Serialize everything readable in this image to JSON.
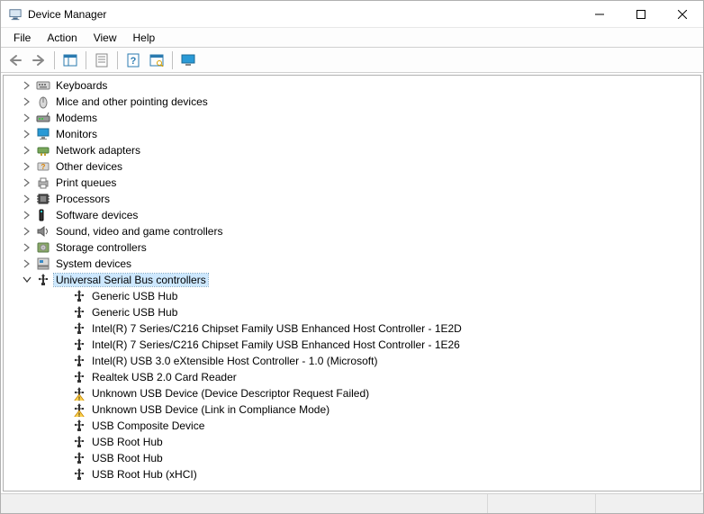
{
  "window": {
    "title": "Device Manager"
  },
  "menu": {
    "file": "File",
    "action": "Action",
    "view": "View",
    "help": "Help"
  },
  "toolbar_icons": {
    "back": "back-icon",
    "forward": "forward-icon",
    "show_hide": "show-hide-console-tree-icon",
    "properties": "properties-icon",
    "help": "help-icon",
    "scan": "scan-hardware-icon",
    "view_devices": "view-devices-icon"
  },
  "tree": {
    "nodes": [
      {
        "label": "Keyboards",
        "icon": "keyboard-icon",
        "expanded": false
      },
      {
        "label": "Mice and other pointing devices",
        "icon": "mouse-icon",
        "expanded": false
      },
      {
        "label": "Modems",
        "icon": "modem-icon",
        "expanded": false
      },
      {
        "label": "Monitors",
        "icon": "monitor-icon",
        "expanded": false
      },
      {
        "label": "Network adapters",
        "icon": "network-adapter-icon",
        "expanded": false
      },
      {
        "label": "Other devices",
        "icon": "other-device-icon",
        "expanded": false
      },
      {
        "label": "Print queues",
        "icon": "printer-icon",
        "expanded": false
      },
      {
        "label": "Processors",
        "icon": "processor-icon",
        "expanded": false
      },
      {
        "label": "Software devices",
        "icon": "software-device-icon",
        "expanded": false
      },
      {
        "label": "Sound, video and game controllers",
        "icon": "sound-icon",
        "expanded": false
      },
      {
        "label": "Storage controllers",
        "icon": "storage-controller-icon",
        "expanded": false
      },
      {
        "label": "System devices",
        "icon": "system-device-icon",
        "expanded": false
      },
      {
        "label": "Universal Serial Bus controllers",
        "icon": "usb-controller-icon",
        "expanded": true,
        "selected": true,
        "children": [
          {
            "label": "Generic USB Hub",
            "icon": "usb-icon"
          },
          {
            "label": "Generic USB Hub",
            "icon": "usb-icon"
          },
          {
            "label": "Intel(R) 7 Series/C216 Chipset Family USB Enhanced Host Controller - 1E2D",
            "icon": "usb-icon"
          },
          {
            "label": "Intel(R) 7 Series/C216 Chipset Family USB Enhanced Host Controller - 1E26",
            "icon": "usb-icon"
          },
          {
            "label": "Intel(R) USB 3.0 eXtensible Host Controller - 1.0 (Microsoft)",
            "icon": "usb-icon"
          },
          {
            "label": "Realtek USB 2.0 Card Reader",
            "icon": "usb-icon"
          },
          {
            "label": "Unknown USB Device (Device Descriptor Request Failed)",
            "icon": "usb-warning-icon"
          },
          {
            "label": "Unknown USB Device (Link in Compliance Mode)",
            "icon": "usb-warning-icon"
          },
          {
            "label": "USB Composite Device",
            "icon": "usb-icon"
          },
          {
            "label": "USB Root Hub",
            "icon": "usb-icon"
          },
          {
            "label": "USB Root Hub",
            "icon": "usb-icon"
          },
          {
            "label": "USB Root Hub (xHCI)",
            "icon": "usb-icon"
          }
        ]
      }
    ]
  }
}
